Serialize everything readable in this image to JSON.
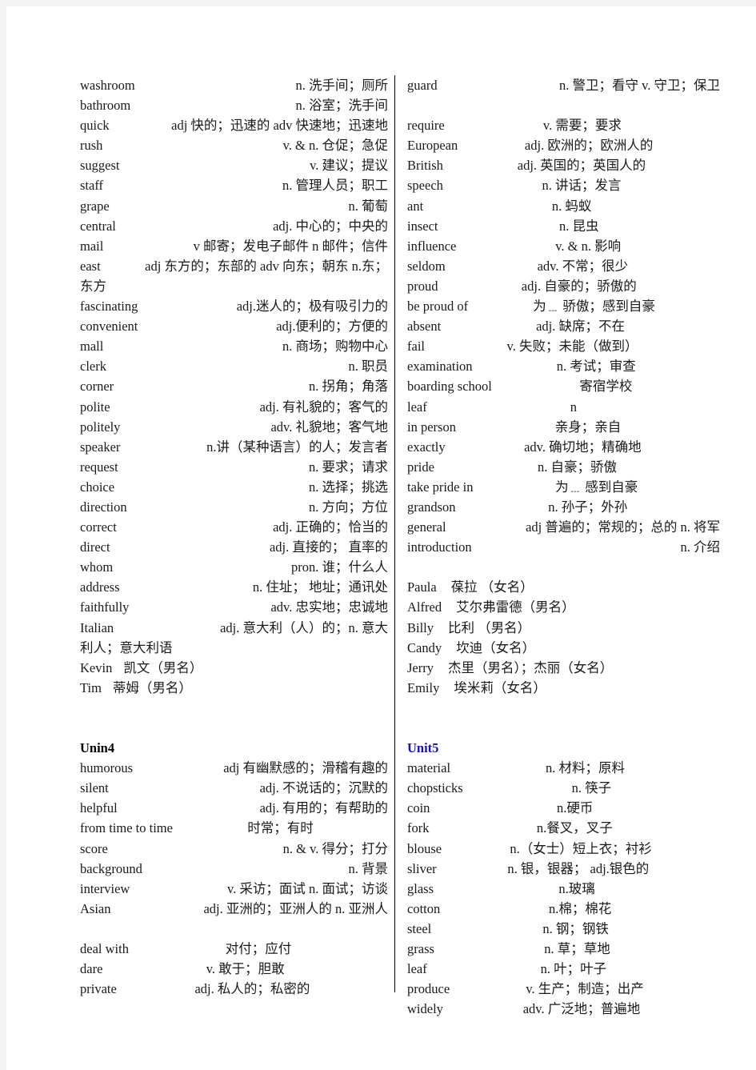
{
  "document": {
    "title": "English Vocabulary List (Units 4-5)",
    "heading_accent_color": "#1111cc",
    "text_color": "#1a1a1a",
    "page_background": "#ffffff"
  },
  "left_column": {
    "entries": [
      {
        "term": "washroom",
        "def": "n.  洗手间；厕所",
        "align": "right"
      },
      {
        "term": "bathroom",
        "def": "n.  浴室；洗手间",
        "align": "right"
      },
      {
        "term": "quick",
        "def": "adj 快的；迅速的 adv  快速地；迅速地",
        "align": "right"
      },
      {
        "term": "rush",
        "def": "v. & n.  仓促；急促",
        "align": "right"
      },
      {
        "term": "suggest",
        "def": "v.  建议；提议",
        "align": "right"
      },
      {
        "term": "staff",
        "def": "n.  管理人员；职工",
        "align": "right"
      },
      {
        "term": "grape",
        "def": "n.  葡萄",
        "align": "right"
      },
      {
        "term": "central",
        "def": "adj.  中心的；中央的",
        "align": "right"
      },
      {
        "term": "mail",
        "def": "v 邮寄；发电子邮件 n  邮件；信件",
        "align": "right"
      },
      {
        "term": "east",
        "def": "adj 东方的；东部的 adv 向东；朝东 n.东；",
        "align": "right",
        "continuation": "东方"
      },
      {
        "term": "fascinating",
        "def": "adj.迷人的；极有吸引力的",
        "align": "right"
      },
      {
        "term": "convenient",
        "def": "adj.便利的；方便的",
        "align": "right"
      },
      {
        "term": "mall",
        "def": "n.  商场；购物中心",
        "align": "right"
      },
      {
        "term": "clerk",
        "def": "n.  职员",
        "align": "right"
      },
      {
        "term": "corner",
        "def": "n.  拐角；角落",
        "align": "right"
      },
      {
        "term": "polite",
        "def": "adj.  有礼貌的；客气的",
        "align": "right"
      },
      {
        "term": "politely",
        "def": "adv.  礼貌地；客气地",
        "align": "right"
      },
      {
        "term": "speaker",
        "def": "n.讲（某种语言）的人；发言者",
        "align": "right"
      },
      {
        "term": "request",
        "def": "n.  要求；请求",
        "align": "right"
      },
      {
        "term": "choice",
        "def": "n.  选择；挑选",
        "align": "right"
      },
      {
        "term": "direction",
        "def": "n.  方向；方位",
        "align": "right"
      },
      {
        "term": "correct",
        "def": "adj.  正确的；恰当的",
        "align": "right"
      },
      {
        "term": "direct",
        "def": "adj.  直接的；  直率的",
        "align": "right"
      },
      {
        "term": "whom",
        "def": "pron.  谁；什么人",
        "align": "right"
      },
      {
        "term": "address",
        "def": "n.  住址；  地址；通讯处",
        "align": "right"
      },
      {
        "term": "faithfully",
        "def": "adv.  忠实地；忠诚地",
        "align": "right"
      },
      {
        "term": "Italian",
        "def": "adj.  意大利（人）的；n.  意大",
        "align": "right",
        "continuation": "利人；意大利语"
      },
      {
        "term": "Kevin",
        "def": "凯文（男名）",
        "align": "name"
      },
      {
        "term": "Tim",
        "def": "蒂姆（男名）",
        "align": "name"
      }
    ],
    "section": {
      "heading": "Unin4",
      "heading_style": "black",
      "entries": [
        {
          "term": "humorous",
          "def": "adj 有幽默感的；滑稽有趣的",
          "align": "right"
        },
        {
          "term": "silent",
          "def": "adj.  不说话的；沉默的",
          "align": "right"
        },
        {
          "term": "helpful",
          "def": "adj.  有用的；有帮助的",
          "align": "right"
        },
        {
          "term": "from time to time",
          "def": "时常；有时",
          "align": "center"
        },
        {
          "term": "score",
          "def": "n. & v.  得分；打分",
          "align": "right"
        },
        {
          "term": "background",
          "def": "n.  背景",
          "align": "right"
        },
        {
          "term": "interview",
          "def": "v.  采访；面试 n.  面试；访谈",
          "align": "right"
        },
        {
          "term": "Asian",
          "def": "adj.  亚洲的；亚洲人的  n.  亚洲人",
          "align": "right"
        }
      ],
      "entries_after_gap": [
        {
          "term": "deal with",
          "def": "对付；应付",
          "align": "center"
        },
        {
          "term": "dare",
          "def": "v.  敢于；胆敢",
          "align": "center"
        },
        {
          "term": "private",
          "def": "adj.  私人的；私密的",
          "align": "center"
        }
      ]
    }
  },
  "right_column": {
    "entries_first": [
      {
        "term": "guard",
        "def": "n.  警卫；看守 v.  守卫；保卫",
        "align": "right"
      }
    ],
    "entries": [
      {
        "term": "require",
        "def": "v.  需要；要求",
        "align": "center"
      },
      {
        "term": "European",
        "def": "adj.  欧洲的；欧洲人的",
        "align": "center"
      },
      {
        "term": "British",
        "def": "adj.  英国的；英国人的",
        "align": "center"
      },
      {
        "term": "speech",
        "def": "n.  讲话；发言",
        "align": "center"
      },
      {
        "term": "ant",
        "def": "n.  蚂蚁",
        "align": "center"
      },
      {
        "term": "insect",
        "def": "n.  昆虫",
        "align": "center"
      },
      {
        "term": "influence",
        "def": "v. & n.  影响",
        "align": "center"
      },
      {
        "term": "seldom",
        "def": "adv.  不常；很少",
        "align": "center"
      },
      {
        "term": "proud",
        "def": "adj.  自豪的；骄傲的",
        "align": "center"
      },
      {
        "term": "be proud of",
        "def": "为﹍ 骄傲；感到自豪",
        "align": "center"
      },
      {
        "term": "absent",
        "def": "adj.  缺席；不在",
        "align": "center"
      },
      {
        "term": "fail",
        "def": "v.  失败；未能（做到）",
        "align": "center"
      },
      {
        "term": "examination",
        "def": "n.  考试；审查",
        "align": "center"
      },
      {
        "term": "boarding    school",
        "def": "寄宿学校",
        "align": "center"
      },
      {
        "term": "leaf",
        "def": "n",
        "align": "center"
      },
      {
        "term": "in person",
        "def": "亲身；亲自",
        "align": "center"
      },
      {
        "term": "exactly",
        "def": "adv.  确切地；精确地",
        "align": "center"
      },
      {
        "term": "pride",
        "def": "n.  自豪；骄傲",
        "align": "center"
      },
      {
        "term": "take pride in",
        "def": "为﹍ 感到自豪",
        "align": "center"
      },
      {
        "term": "grandson",
        "def": "n.  孙子；外孙",
        "align": "center"
      },
      {
        "term": "general",
        "def": "adj 普遍的；常规的；总的 n.  将军",
        "align": "right"
      },
      {
        "term": "introduction",
        "def": "n.  介绍",
        "align": "right"
      }
    ],
    "names": [
      {
        "term": "Paula",
        "def": "葆拉  （女名）"
      },
      {
        "term": "Alfred",
        "def": "艾尔弗雷德（男名）"
      },
      {
        "term": "Billy",
        "def": "比利  （男名）"
      },
      {
        "term": "Candy",
        "def": "坎迪（女名）"
      },
      {
        "term": "Jerry",
        "def": "杰里（男名）；杰丽（女名）"
      },
      {
        "term": "Emily",
        "def": "埃米莉（女名）"
      }
    ],
    "section": {
      "heading": "Unit5",
      "heading_style": "blue",
      "entries": [
        {
          "term": "material",
          "def": "n.  材料；原料",
          "align": "center"
        },
        {
          "term": "chopsticks",
          "def": "n.    筷子",
          "align": "center"
        },
        {
          "term": "coin",
          "def": "n.硬币",
          "align": "center"
        },
        {
          "term": "fork",
          "def": "n.餐叉，叉子",
          "align": "center"
        },
        {
          "term": "blouse",
          "def": "n.（女士）短上衣；衬衫",
          "align": "center"
        },
        {
          "term": "sliver",
          "def": "n.  银，银器；   adj.银色的",
          "align": "center"
        },
        {
          "term": "glass",
          "def": "n.玻璃",
          "align": "center"
        },
        {
          "term": "cotton",
          "def": "n.棉；棉花",
          "align": "center"
        },
        {
          "term": "steel",
          "def": "n.  钢；钢铁",
          "align": "center"
        },
        {
          "term": "grass",
          "def": "n.  草；草地",
          "align": "center"
        },
        {
          "term": "leaf",
          "def": "n.  叶；叶子",
          "align": "center"
        },
        {
          "term": "produce",
          "def": "v.  生产；制造；出产",
          "align": "center"
        },
        {
          "term": "widely",
          "def": "adv.  广泛地；普遍地",
          "align": "center"
        }
      ]
    }
  }
}
